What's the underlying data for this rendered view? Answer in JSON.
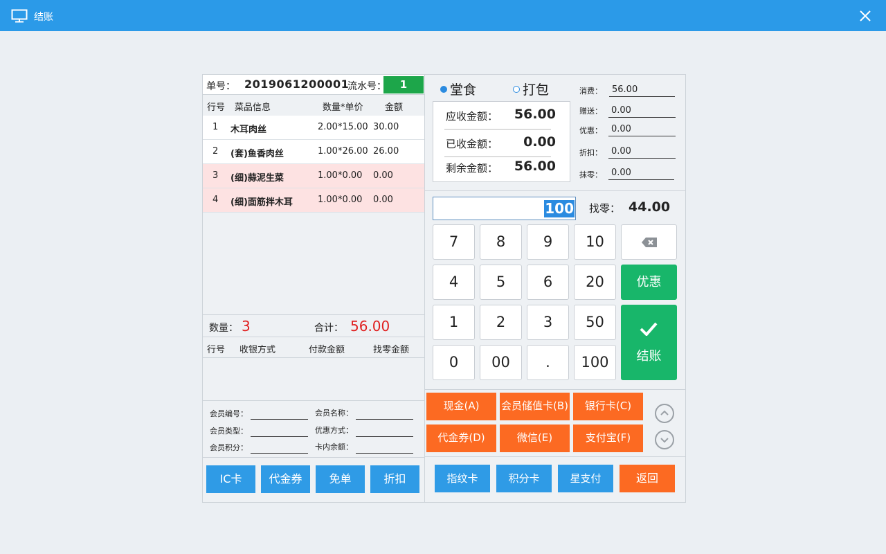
{
  "window": {
    "title": "结账",
    "icon": "monitor-icon",
    "close_icon": "close-icon"
  },
  "order": {
    "order_no_label": "单号：",
    "order_no": "2019061200001",
    "serial_label": "流水号：",
    "serial": "1"
  },
  "items_header": {
    "line": "行号",
    "info": "菜品信息",
    "qty_price": "数量*单价",
    "amount": "金额"
  },
  "items": [
    {
      "line": "1",
      "name": "木耳肉丝",
      "qty_price": "2.00*15.00",
      "amount": "30.00"
    },
    {
      "line": "2",
      "name": "(套)鱼香肉丝",
      "qty_price": "1.00*26.00",
      "amount": "26.00"
    },
    {
      "line": "3",
      "name": "(细)蒜泥生菜",
      "qty_price": "1.00*0.00",
      "amount": "0.00"
    },
    {
      "line": "4",
      "name": "(细)面筋拌木耳",
      "qty_price": "1.00*0.00",
      "amount": "0.00"
    }
  ],
  "summary": {
    "qty_label": "数量：",
    "qty": "3",
    "total_label": "合计：",
    "total": "56.00"
  },
  "payments_header": {
    "line": "行号",
    "method": "收银方式",
    "paid": "付款金额",
    "change": "找零金额"
  },
  "member": {
    "no_label": "会员编号：",
    "name_label": "会员名称：",
    "type_label": "会员类型：",
    "discount_label": "优惠方式：",
    "points_label": "会员积分：",
    "balance_label": "卡内余额："
  },
  "left_buttons": [
    "IC卡",
    "代金券",
    "免单",
    "折扣"
  ],
  "dining": {
    "dine_in": "堂食",
    "takeaway": "打包",
    "selected": "堂食"
  },
  "amounts": {
    "receivable_label": "应收金额：",
    "receivable": "56.00",
    "received_label": "已收金额：",
    "received": "0.00",
    "remaining_label": "剩余金额：",
    "remaining": "56.00"
  },
  "stats": {
    "spend_label": "消费：",
    "spend": "56.00",
    "gift_label": "赠送：",
    "gift": "0.00",
    "discount_label": "优惠：",
    "discount": "0.00",
    "rebate_label": "折扣：",
    "rebate": "0.00",
    "round_label": "抹零：",
    "round": "0.00"
  },
  "input": {
    "value": "100",
    "change_label": "找零：",
    "change": "44.00"
  },
  "keypad": {
    "keys": [
      "7",
      "8",
      "9",
      "10",
      "4",
      "5",
      "6",
      "20",
      "1",
      "2",
      "3",
      "50",
      "0",
      "00",
      ".",
      "100"
    ],
    "backspace_icon": "backspace-icon",
    "discount": "优惠",
    "checkout": "结账",
    "checkout_icon": "checkmark-icon"
  },
  "pay_methods": [
    "现金(A)",
    "会员储值卡(B)",
    "银行卡(C)",
    "代金券(D)",
    "微信(E)",
    "支付宝(F)"
  ],
  "scroll": {
    "up_icon": "chevron-up-icon",
    "down_icon": "chevron-down-icon"
  },
  "bottom_buttons": [
    "指纹卡",
    "积分卡",
    "星支付"
  ],
  "back_button": "返回",
  "colors": {
    "titlebar": "#2b9ae8",
    "blue_button": "#2f9be6",
    "orange_button": "#fc6a22",
    "green_button": "#18b66a",
    "serial_green": "#1da64a",
    "red_text": "#e02020"
  }
}
